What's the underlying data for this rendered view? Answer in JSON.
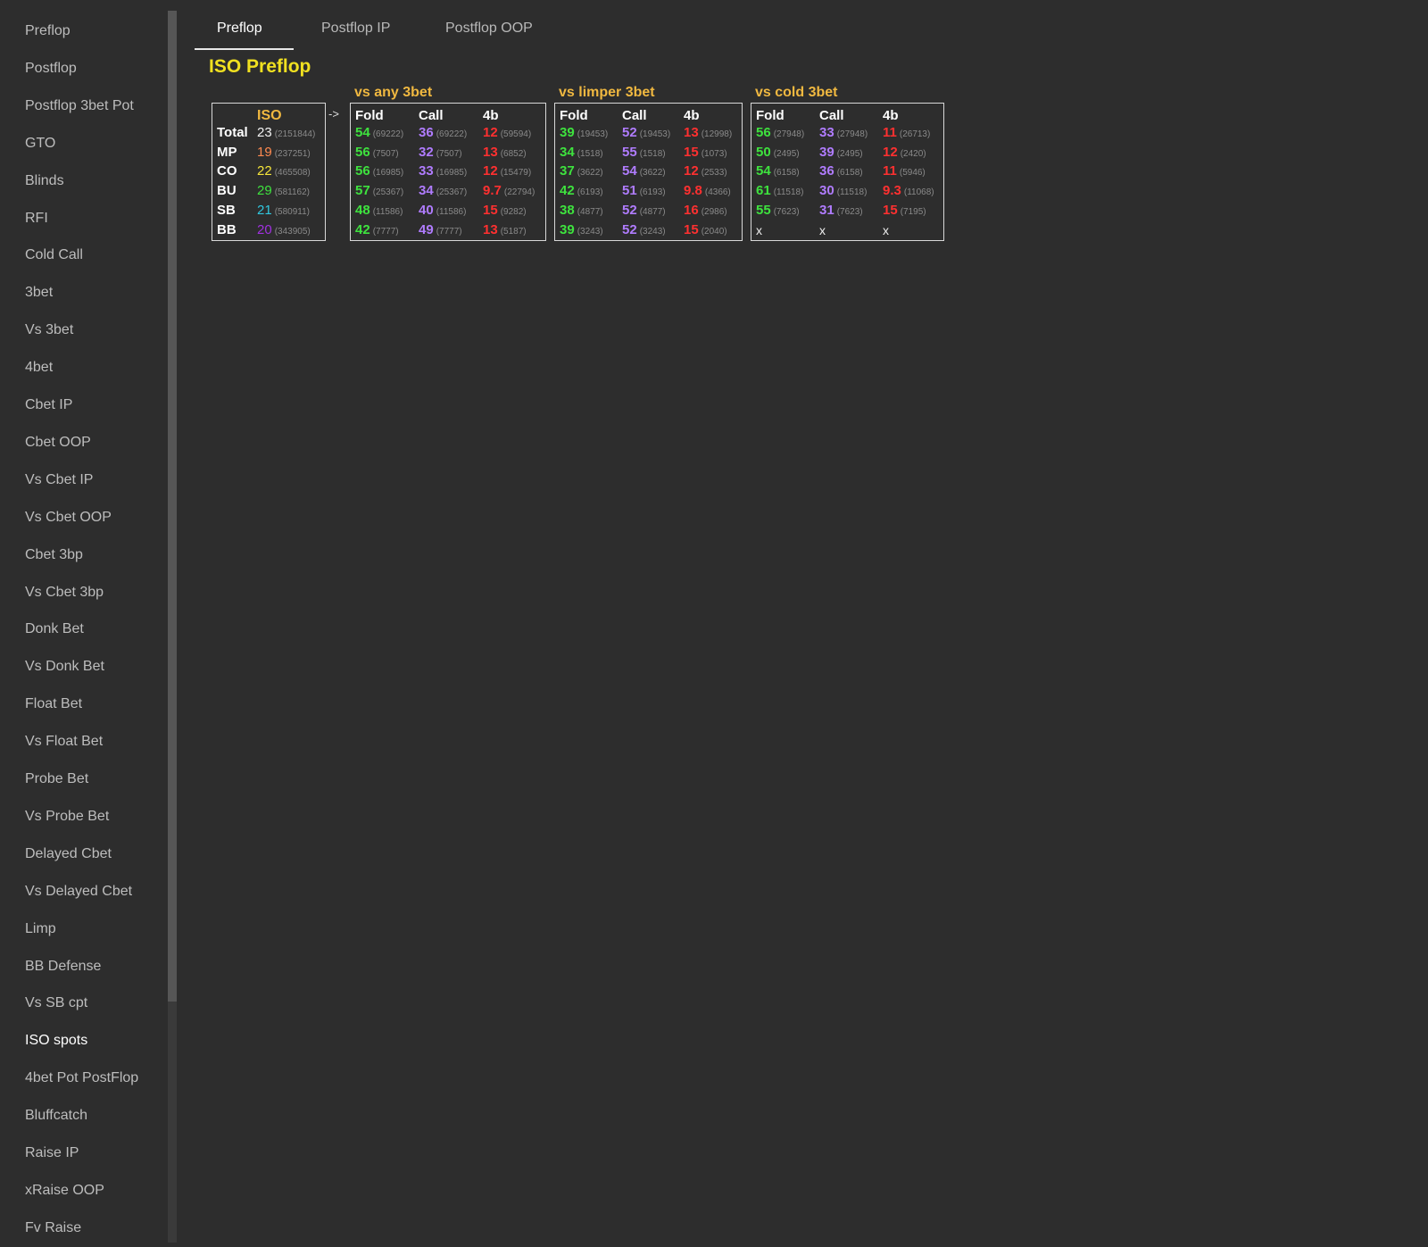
{
  "sidebar": {
    "items": [
      "Preflop",
      "Postflop",
      "Postflop 3bet Pot",
      "GTO",
      "Blinds",
      "RFI",
      "Cold Call",
      "3bet",
      "Vs 3bet",
      "4bet",
      "Cbet IP",
      "Cbet OOP",
      "Vs Cbet IP",
      "Vs Cbet OOP",
      "Cbet 3bp",
      "Vs Cbet 3bp",
      "Donk Bet",
      "Vs Donk Bet",
      "Float Bet",
      "Vs Float Bet",
      "Probe Bet",
      "Vs Probe Bet",
      "Delayed Cbet",
      "Vs Delayed Cbet",
      "Limp",
      "BB Defense",
      "Vs SB cpt",
      "ISO spots",
      "4bet Pot PostFlop",
      "Bluffcatch",
      "Raise IP",
      "xRaise OOP",
      "Fv Raise"
    ],
    "active_index": 27
  },
  "tabs": [
    "Preflop",
    "Postflop IP",
    "Postflop OOP"
  ],
  "active_tab": 0,
  "page_title": "ISO Preflop",
  "arrow": "->",
  "colors": {
    "title": "#f0e020",
    "group_title": "#f0b840",
    "fold": "#3ee23e",
    "call": "#b07cff",
    "four_bet": "#ff3030"
  },
  "iso_table": {
    "header": "ISO",
    "rows": [
      {
        "pos": "Total",
        "value": "23",
        "count": "(2151844)",
        "color": "#f2f2f2"
      },
      {
        "pos": "MP",
        "value": "19",
        "count": "(237251)",
        "color": "#ff8a50"
      },
      {
        "pos": "CO",
        "value": "22",
        "count": "(465508)",
        "color": "#f5e53a"
      },
      {
        "pos": "BU",
        "value": "29",
        "count": "(581162)",
        "color": "#3ee23e"
      },
      {
        "pos": "SB",
        "value": "21",
        "count": "(580911)",
        "color": "#30c8e0"
      },
      {
        "pos": "BB",
        "value": "20",
        "count": "(343905)",
        "color": "#a030e0"
      }
    ]
  },
  "groups": [
    {
      "title": "vs any 3bet",
      "headers": [
        "Fold",
        "Call",
        "4b"
      ],
      "rows": [
        [
          [
            "54",
            "(69222)"
          ],
          [
            "36",
            "(69222)"
          ],
          [
            "12",
            "(59594)"
          ]
        ],
        [
          [
            "56",
            "(7507)"
          ],
          [
            "32",
            "(7507)"
          ],
          [
            "13",
            "(6852)"
          ]
        ],
        [
          [
            "56",
            "(16985)"
          ],
          [
            "33",
            "(16985)"
          ],
          [
            "12",
            "(15479)"
          ]
        ],
        [
          [
            "57",
            "(25367)"
          ],
          [
            "34",
            "(25367)"
          ],
          [
            "9.7",
            "(22794)"
          ]
        ],
        [
          [
            "48",
            "(11586)"
          ],
          [
            "40",
            "(11586)"
          ],
          [
            "15",
            "(9282)"
          ]
        ],
        [
          [
            "42",
            "(7777)"
          ],
          [
            "49",
            "(7777)"
          ],
          [
            "13",
            "(5187)"
          ]
        ]
      ]
    },
    {
      "title": "vs limper 3bet",
      "headers": [
        "Fold",
        "Call",
        "4b"
      ],
      "rows": [
        [
          [
            "39",
            "(19453)"
          ],
          [
            "52",
            "(19453)"
          ],
          [
            "13",
            "(12998)"
          ]
        ],
        [
          [
            "34",
            "(1518)"
          ],
          [
            "55",
            "(1518)"
          ],
          [
            "15",
            "(1073)"
          ]
        ],
        [
          [
            "37",
            "(3622)"
          ],
          [
            "54",
            "(3622)"
          ],
          [
            "12",
            "(2533)"
          ]
        ],
        [
          [
            "42",
            "(6193)"
          ],
          [
            "51",
            "(6193)"
          ],
          [
            "9.8",
            "(4366)"
          ]
        ],
        [
          [
            "38",
            "(4877)"
          ],
          [
            "52",
            "(4877)"
          ],
          [
            "16",
            "(2986)"
          ]
        ],
        [
          [
            "39",
            "(3243)"
          ],
          [
            "52",
            "(3243)"
          ],
          [
            "15",
            "(2040)"
          ]
        ]
      ]
    },
    {
      "title": "vs cold 3bet",
      "headers": [
        "Fold",
        "Call",
        "4b"
      ],
      "rows": [
        [
          [
            "56",
            "(27948)"
          ],
          [
            "33",
            "(27948)"
          ],
          [
            "11",
            "(26713)"
          ]
        ],
        [
          [
            "50",
            "(2495)"
          ],
          [
            "39",
            "(2495)"
          ],
          [
            "12",
            "(2420)"
          ]
        ],
        [
          [
            "54",
            "(6158)"
          ],
          [
            "36",
            "(6158)"
          ],
          [
            "11",
            "(5946)"
          ]
        ],
        [
          [
            "61",
            "(11518)"
          ],
          [
            "30",
            "(11518)"
          ],
          [
            "9.3",
            "(11068)"
          ]
        ],
        [
          [
            "55",
            "(7623)"
          ],
          [
            "31",
            "(7623)"
          ],
          [
            "15",
            "(7195)"
          ]
        ],
        [
          [
            "x",
            ""
          ],
          [
            "x",
            ""
          ],
          [
            "x",
            ""
          ]
        ]
      ]
    }
  ]
}
